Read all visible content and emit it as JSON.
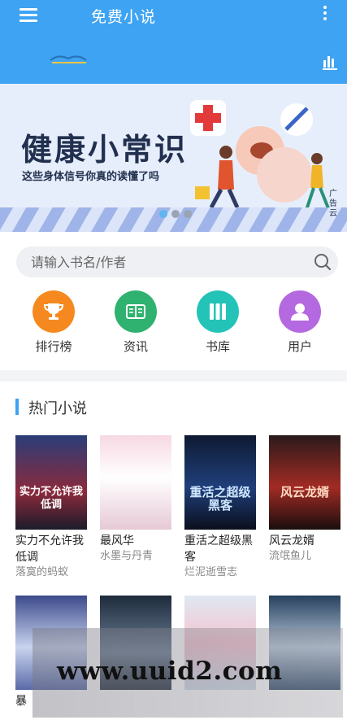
{
  "header": {
    "title": "免费小说"
  },
  "banner": {
    "title": "健康小常识",
    "subtitle": "这些身体信号你真的读懂了吗",
    "side_text": "广告云"
  },
  "search": {
    "placeholder": "请输入书名/作者"
  },
  "categories": [
    {
      "label": "排行榜",
      "color": "#f5891f",
      "icon": "trophy-icon"
    },
    {
      "label": "资讯",
      "color": "#2fb26f",
      "icon": "book-open-icon"
    },
    {
      "label": "书库",
      "color": "#24c3b8",
      "icon": "library-icon"
    },
    {
      "label": "用户",
      "color": "#b469e0",
      "icon": "user-icon"
    }
  ],
  "hot": {
    "title": "热门小说",
    "books": [
      {
        "title": "实力不允许我低调",
        "author": "落寞的蚂蚁",
        "cover_text": "实力不允许我低调"
      },
      {
        "title": "最风华",
        "author": "水墨与丹青",
        "cover_text": ""
      },
      {
        "title": "重活之超级黑客",
        "author": "烂泥逝雪志",
        "cover_text": "重活之超级黑客"
      },
      {
        "title": "风云龙婿",
        "author": "流氓鱼儿",
        "cover_text": "风云龙婿"
      },
      {
        "title": "暴",
        "author": ""
      },
      {
        "title": "",
        "author": ""
      },
      {
        "title": "",
        "author": ""
      },
      {
        "title": "",
        "author": ""
      }
    ]
  },
  "watermark": {
    "text": "www.uuid2.com"
  }
}
